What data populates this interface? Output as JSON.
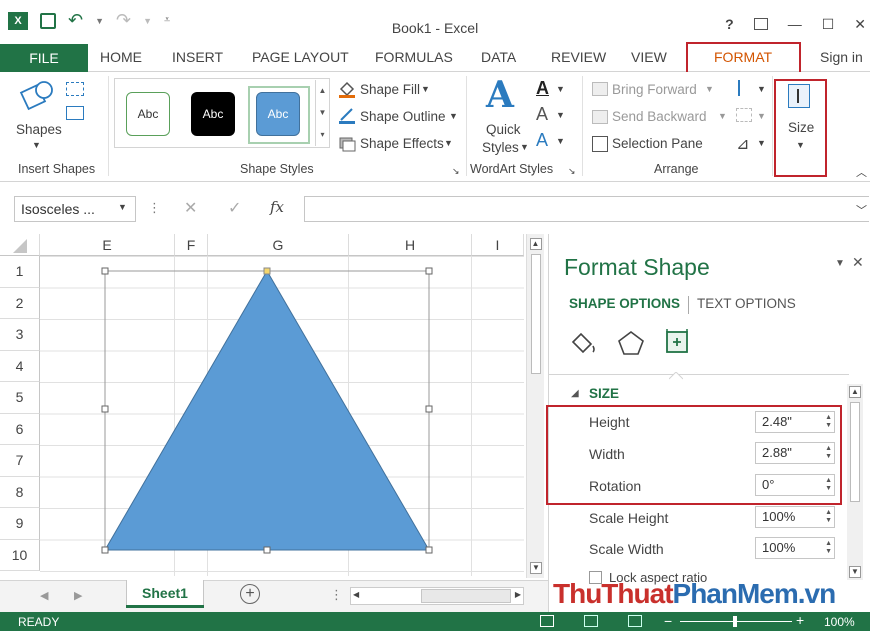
{
  "window": {
    "title": "Book1 - Excel",
    "help": "?",
    "minimize": "—",
    "maximize": "☐",
    "close": "✕"
  },
  "tabs": [
    "FILE",
    "HOME",
    "INSERT",
    "PAGE LAYOUT",
    "FORMULAS",
    "DATA",
    "REVIEW",
    "VIEW",
    "FORMAT"
  ],
  "sign_in": "Sign in",
  "ribbon": {
    "insert_shapes": {
      "shapes_label": "Shapes",
      "group_label": "Insert Shapes"
    },
    "shape_styles": {
      "presets": [
        "Abc",
        "Abc",
        "Abc"
      ],
      "fill": "Shape Fill",
      "outline": "Shape Outline",
      "effects": "Shape Effects",
      "group_label": "Shape Styles"
    },
    "wordart": {
      "quick_styles": "Quick",
      "quick_styles2": "Styles",
      "group_label": "WordArt Styles"
    },
    "arrange": {
      "bring_forward": "Bring Forward",
      "send_backward": "Send Backward",
      "selection_pane": "Selection Pane",
      "group_label": "Arrange"
    },
    "size": {
      "label": "Size"
    }
  },
  "formula_bar": {
    "name_box": "Isosceles ...",
    "cancel": "✕",
    "enter": "✓",
    "fx": "fx",
    "value": ""
  },
  "grid": {
    "columns": [
      "E",
      "F",
      "G",
      "H",
      "I"
    ],
    "rows": [
      "1",
      "2",
      "3",
      "4",
      "5",
      "6",
      "7",
      "8",
      "9",
      "10"
    ]
  },
  "format_pane": {
    "title": "Format Shape",
    "tab_shape": "SHAPE OPTIONS",
    "tab_text": "TEXT OPTIONS",
    "section": "SIZE",
    "height_label": "Height",
    "height_value": "2.48\"",
    "width_label": "Width",
    "width_value": "2.88\"",
    "rotation_label": "Rotation",
    "rotation_value": "0°",
    "scale_height_label": "Scale Height",
    "scale_height_value": "100%",
    "scale_width_label": "Scale Width",
    "scale_width_value": "100%",
    "lock_aspect": "Lock aspect ratio"
  },
  "sheets": [
    "Sheet1"
  ],
  "status": {
    "ready": "READY",
    "zoom": "100%"
  },
  "watermark": {
    "part1": "ThuThuat",
    "part2": "PhanMem",
    "part3": ".vn"
  },
  "colors": {
    "excel_green": "#217346",
    "shape_fill": "#5b9bd5",
    "highlight_red": "#c0242c",
    "format_orange": "#d35400"
  }
}
